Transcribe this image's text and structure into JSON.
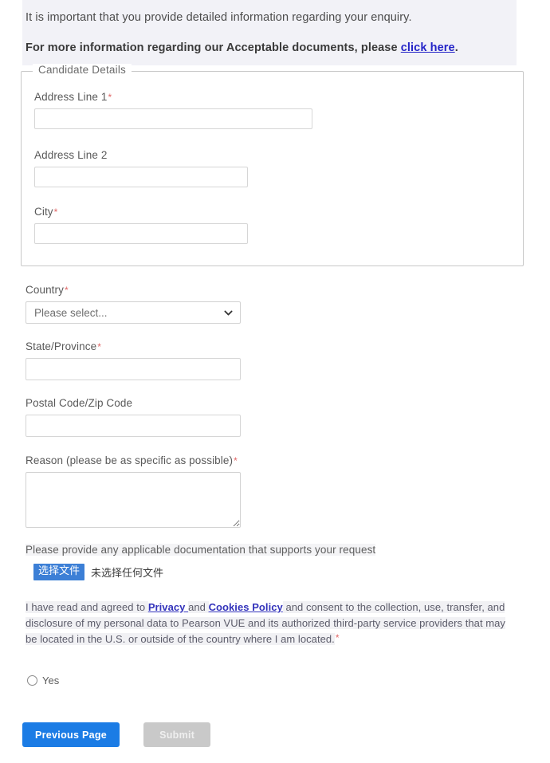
{
  "intro": {
    "line1": "It is important that you provide detailed information regarding your enquiry.",
    "line2_prefix": "For more information regarding our Acceptable documents, please ",
    "line2_link": "click here",
    "line2_suffix": "."
  },
  "fieldset": {
    "legend": "Candidate Details",
    "fields": [
      {
        "label": "Address Line 1",
        "required": true,
        "value": "",
        "placeholder": ""
      },
      {
        "label": "Address Line 2",
        "required": false,
        "value": "",
        "placeholder": ""
      },
      {
        "label": "City",
        "required": true,
        "value": "",
        "placeholder": ""
      }
    ]
  },
  "form": {
    "country": {
      "label": "Country",
      "required": true,
      "selected": "Please select...",
      "options": [
        "Please select..."
      ],
      "icon": "chevron-down-icon"
    },
    "state": {
      "label": "State/Province",
      "required": true,
      "value": "",
      "placeholder": ""
    },
    "postal": {
      "label": "Postal Code/Zip Code",
      "required": false,
      "value": "",
      "placeholder": ""
    },
    "reason": {
      "label": "Reason (please be as specific as possible)",
      "required": true,
      "value": "",
      "placeholder": ""
    }
  },
  "upload": {
    "instruction": "Please provide any applicable documentation that supports your request",
    "button_label": "选择文件",
    "status": "未选择任何文件"
  },
  "consent": {
    "part1": "I have read and agreed to ",
    "link1": "Privacy ",
    "part2": "and ",
    "link2": "Cookies Policy",
    "part3": " and consent to the collection, use, transfer, and disclosure of my personal data to Pearson VUE and its authorized third-party service providers that may be located in the U.S. or outside of the country where I am located.",
    "required_marker": "*",
    "radio_label": "Yes"
  },
  "buttons": {
    "previous": "Previous Page",
    "submit": "Submit"
  },
  "colors": {
    "primary_blue": "#1b7ce5",
    "disabled_gray": "#c9c9c9",
    "link_purple": "#2424c8",
    "link_blue": "#3333bb",
    "required_red": "#e06666",
    "banner_bg": "#f2f2f7",
    "file_button_blue": "#3c7fd6"
  }
}
